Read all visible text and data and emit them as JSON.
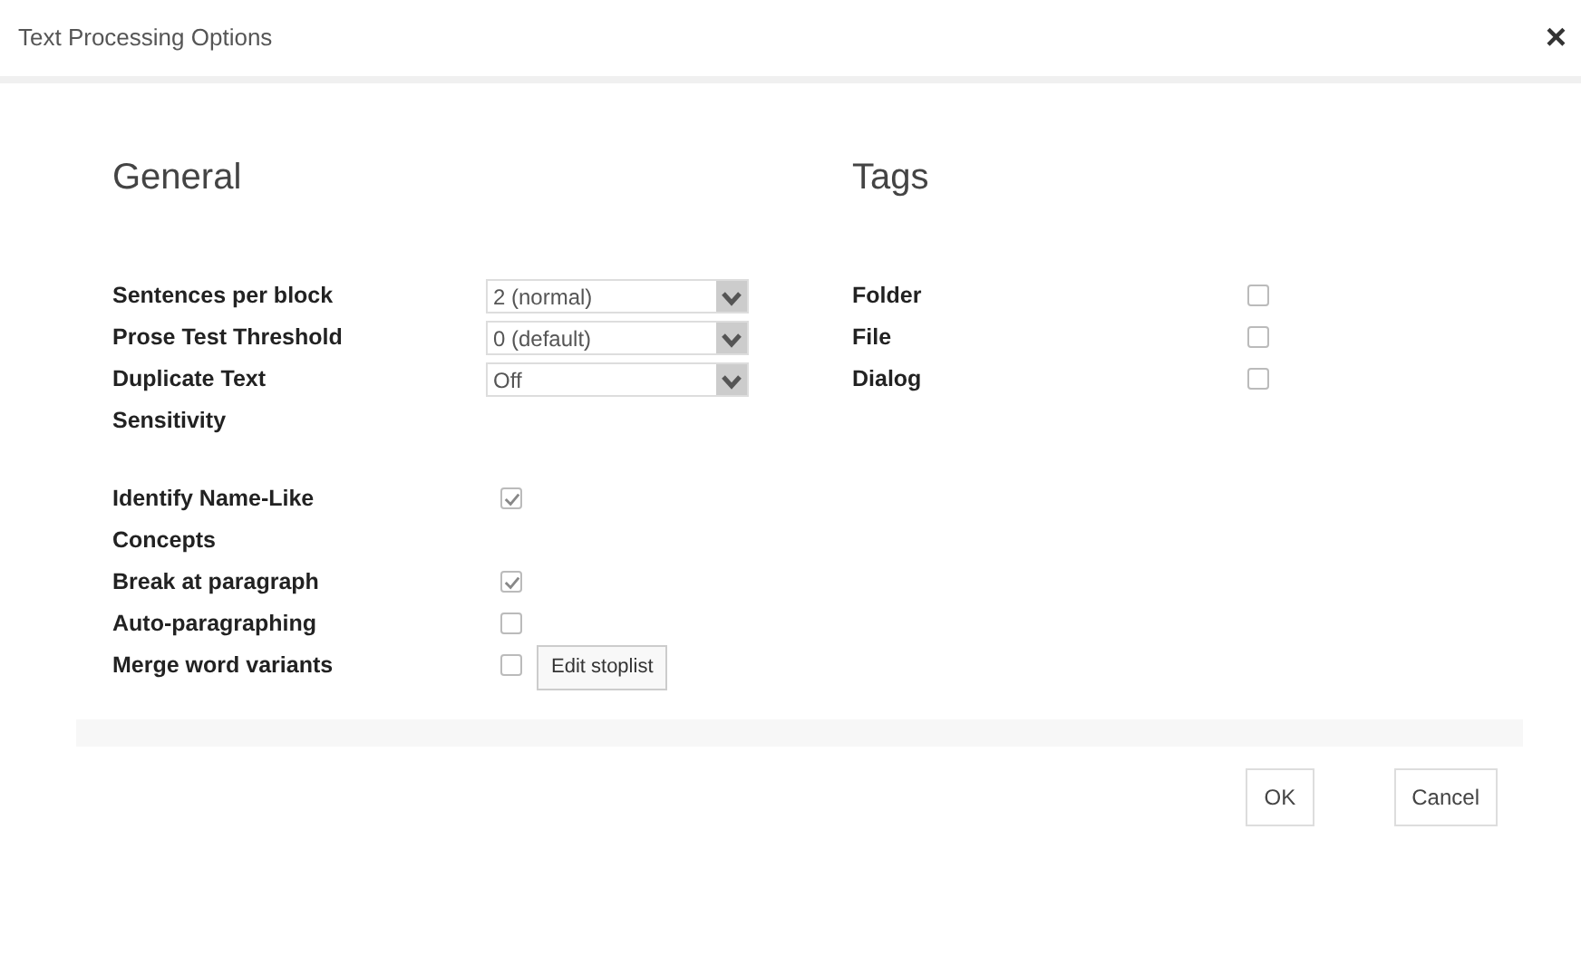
{
  "window": {
    "title": "Text Processing Options",
    "close": "×"
  },
  "general": {
    "heading": "General",
    "options": [
      {
        "kind": "select",
        "label": "Sentences per block",
        "value": "2 (normal)"
      },
      {
        "kind": "select",
        "label": "Prose Test Threshold",
        "value": "0 (default)"
      },
      {
        "kind": "select",
        "label": "Duplicate Text Sensitivity",
        "value": "Off"
      },
      {
        "kind": "checkbox",
        "label": "Identify Name-Like Concepts",
        "checked": true
      },
      {
        "kind": "checkbox",
        "label": "Break at paragraph",
        "checked": true
      },
      {
        "kind": "checkbox",
        "label": "Auto-paragraphing",
        "checked": false
      },
      {
        "kind": "checkbox",
        "label": "Merge word variants",
        "checked": false,
        "button": "Edit stoplist"
      }
    ]
  },
  "tags": {
    "heading": "Tags",
    "items": [
      {
        "label": "Folder",
        "checked": false
      },
      {
        "label": "File",
        "checked": false
      },
      {
        "label": "Dialog",
        "checked": false
      }
    ]
  },
  "buttons": [
    "OK",
    "Cancel"
  ]
}
